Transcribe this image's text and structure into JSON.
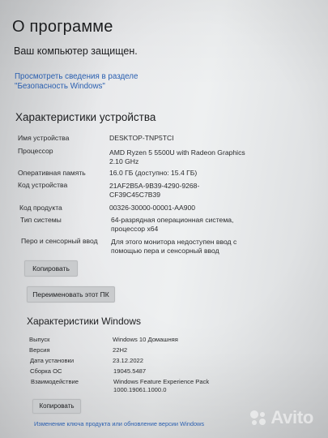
{
  "page_title": "О программе",
  "security_status": "Ваш компьютер защищен.",
  "security_link": "Просмотреть сведения в разделе \"Безопасность Windows\"",
  "device_spec": {
    "title": "Характеристики устройства",
    "rows": [
      {
        "label": "Имя устройства",
        "value": "DESKTOP-TNP5TCI"
      },
      {
        "label": "Процессор",
        "value": "AMD Ryzen 5 5500U with Radeon Graphics\n2.10 GHz"
      },
      {
        "label": "Оперативная память",
        "value": "16.0 ГБ (доступно: 15.4 ГБ)"
      },
      {
        "label": "Код устройства",
        "value": "21AF2B5A-9B39-4290-9268-\nCF39C45C7B39"
      },
      {
        "label": "Код продукта",
        "value": "00326-30000-00001-AA900"
      },
      {
        "label": "Тип системы",
        "value": "64-разрядная операционная система,\nпроцессор x64"
      },
      {
        "label": "Перо и сенсорный ввод",
        "value": "Для этого монитора недоступен ввод с\nпомощью пера и сенсорный ввод"
      }
    ],
    "copy_button": "Копировать",
    "rename_button": "Переименовать этот ПК"
  },
  "windows_spec": {
    "title": "Характеристики Windows",
    "rows": [
      {
        "label": "Выпуск",
        "value": "Windows 10 Домашняя"
      },
      {
        "label": "Версия",
        "value": "22H2"
      },
      {
        "label": "Дата установки",
        "value": "23.12.2022"
      },
      {
        "label": "Сборка ОС",
        "value": "19045.5487"
      },
      {
        "label": "Взаимодействие",
        "value": "Windows Feature Experience Pack\n1000.19061.1000.0"
      }
    ],
    "copy_button": "Копировать",
    "change_key_link": "Изменение ключа продукта или обновление версии Windows"
  },
  "watermark": {
    "text": "Avito",
    "colors": [
      "#ffffff"
    ]
  }
}
